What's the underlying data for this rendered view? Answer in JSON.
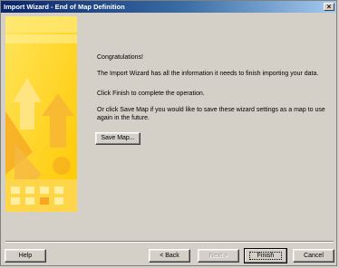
{
  "window": {
    "title": "Import Wizard - End of Map Definition",
    "close_label": "×"
  },
  "content": {
    "congrats": "Congratulations!",
    "info": "The Import Wizard has all the information it needs to finish importing your data.",
    "finish_hint": "Click Finish to complete the operation.",
    "save_hint": "Or click Save Map if you would like to save these wizard settings as a map to use again in the future."
  },
  "buttons": {
    "save_map": "Save Map...",
    "help": "Help",
    "back": "< Back",
    "next": "Next >",
    "finish": "Finish",
    "cancel": "Cancel"
  },
  "colors": {
    "titlebar_start": "#0a246a",
    "titlebar_end": "#a6caf0",
    "dialog_bg": "#d4d0c8",
    "art_yellow": "#ffd21c",
    "art_orange": "#f5a623"
  }
}
